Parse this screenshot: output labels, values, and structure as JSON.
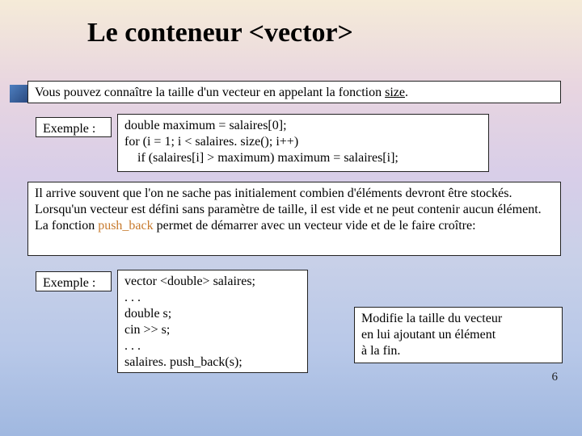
{
  "title": "Le conteneur <vector>",
  "box1_pre": "Vous pouvez connaître la taille d'un vecteur en appelant la fonction ",
  "box1_kw": "size",
  "box1_post": ".",
  "example_label": "Exemple :",
  "code1_l1": "double maximum = salaires[0];",
  "code1_l2": "for (i = 1; i < salaires. size(); i++)",
  "code1_l3": "    if (salaires[i] > maximum) maximum = salaires[i];",
  "box4_pre": "Il arrive souvent que l'on ne sache pas initialement combien d'éléments devront être stockés. Lorsqu'un vecteur est défini sans paramètre de taille, il est vide et ne peut contenir aucun élément. La fonction ",
  "box4_kw": "push_back",
  "box4_post": " permet de démarrer avec un vecteur vide et de le faire croître:",
  "code2_l1": "vector <double> salaires;",
  "code2_l2": ". . .",
  "code2_l3": "double s;",
  "code2_l4": "cin >> s;",
  "code2_l5": ". . .",
  "code2_l6": "salaires. push_back(s);",
  "note_l1": "Modifie la taille du vecteur",
  "note_l2": "en lui ajoutant un élément",
  "note_l3": "à la fin.",
  "page_number": "6"
}
